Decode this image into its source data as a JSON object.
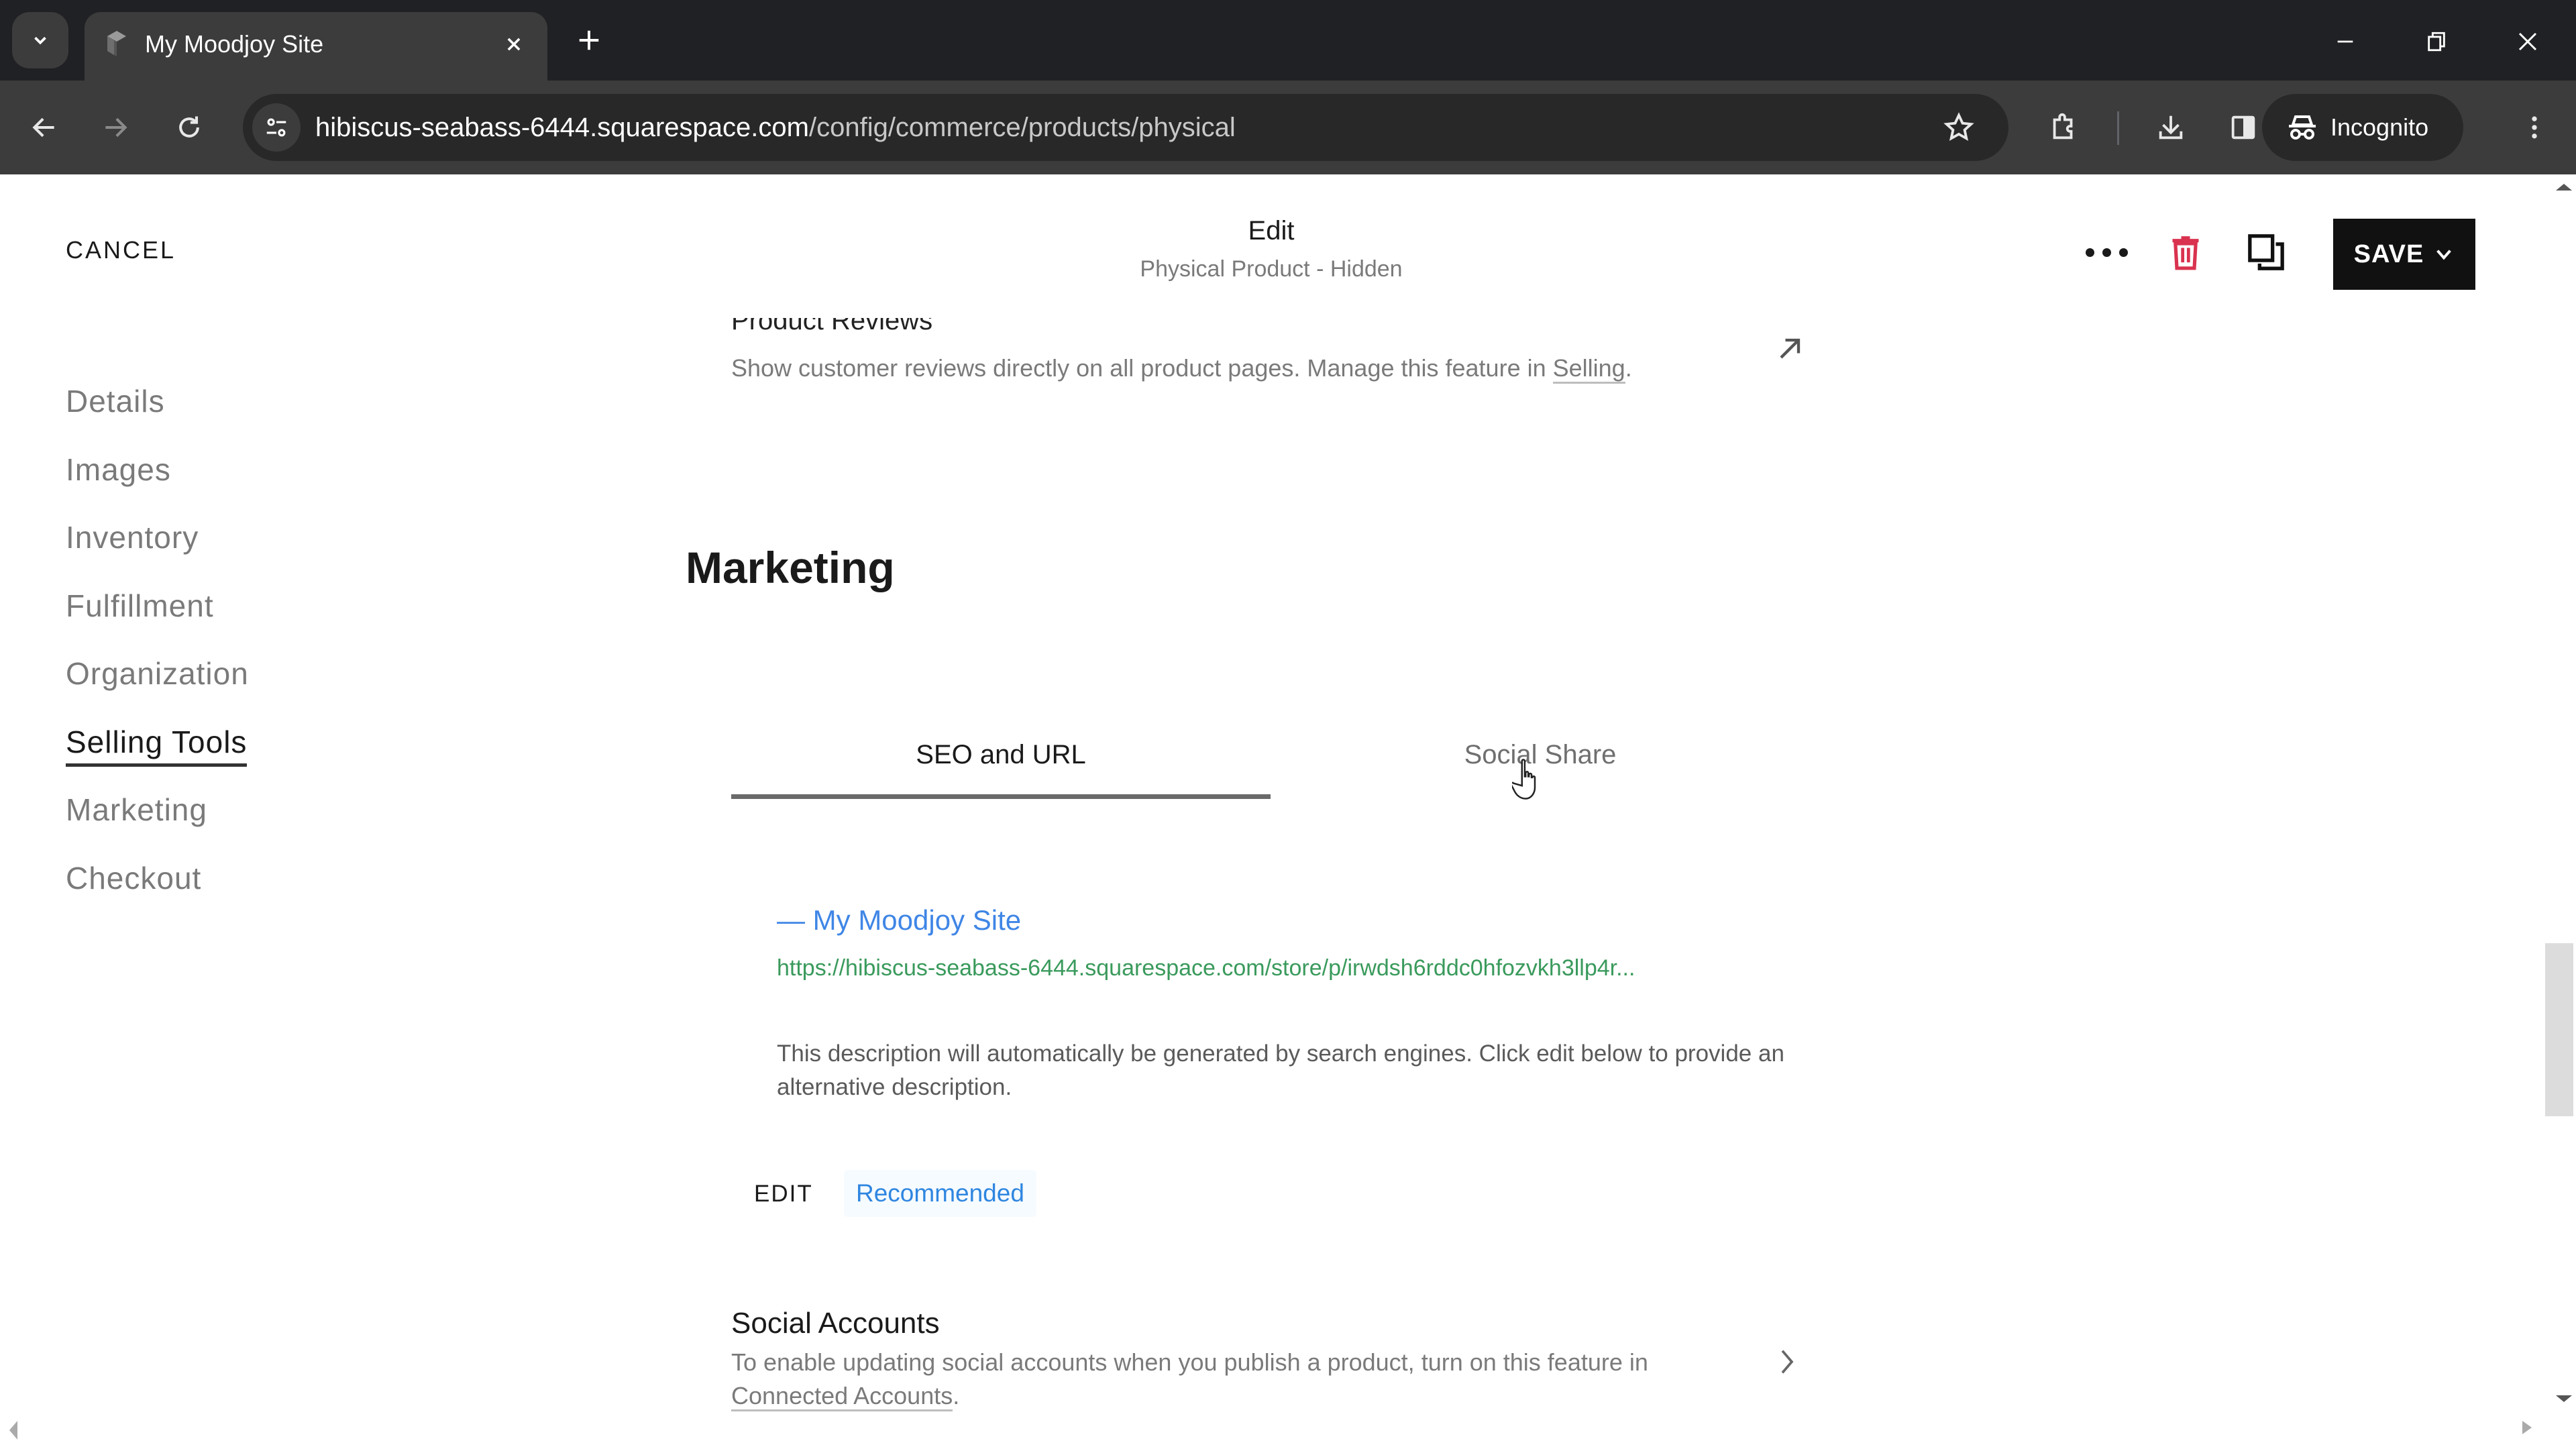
{
  "browser": {
    "tab_title": "My Moodjoy Site",
    "url_host": "hibiscus-seabass-6444.squarespace.com",
    "url_path": "/config/commerce/products/physical",
    "incognito_label": "Incognito",
    "icons": {
      "tab_search": "chevron-down-icon",
      "favicon": "squarespace-cube-icon",
      "tab_close": "close-icon",
      "new_tab": "plus-icon",
      "back": "arrow-left-icon",
      "forward": "arrow-right-icon",
      "reload": "reload-icon",
      "site_info": "tune-icon",
      "bookmark": "star-icon",
      "extensions": "puzzle-icon",
      "downloads": "download-icon",
      "side_panel": "side-panel-icon",
      "incognito": "incognito-icon",
      "menu": "kebab-menu-icon",
      "minimize": "minimize-icon",
      "restore": "restore-icon",
      "close_window": "close-icon"
    }
  },
  "header": {
    "cancel_label": "CANCEL",
    "title": "Edit",
    "subtitle": "Physical Product - Hidden",
    "save_label": "SAVE",
    "colors": {
      "trash": "#d9334f",
      "save_bg": "#111111"
    }
  },
  "sidenav": {
    "items": [
      {
        "label": "Details",
        "active": false
      },
      {
        "label": "Images",
        "active": false
      },
      {
        "label": "Inventory",
        "active": false
      },
      {
        "label": "Fulfillment",
        "active": false
      },
      {
        "label": "Organization",
        "active": false
      },
      {
        "label": "Selling Tools",
        "active": true
      },
      {
        "label": "Marketing",
        "active": false
      },
      {
        "label": "Checkout",
        "active": false
      }
    ]
  },
  "reviews": {
    "title": "Product Reviews",
    "desc_prefix": "Show customer reviews directly on all product pages. Manage this feature in ",
    "desc_link": "Selling",
    "desc_suffix": "."
  },
  "marketing": {
    "title": "Marketing",
    "tabs": [
      {
        "label": "SEO and URL",
        "active": true
      },
      {
        "label": "Social Share",
        "active": false
      }
    ],
    "seo_preview": {
      "site_title": "— My Moodjoy Site",
      "url": "https://hibiscus-seabass-6444.squarespace.com/store/p/irwdsh6rddc0hfozvkh3llp4r...",
      "description": "This description will automatically be generated by search engines. Click edit below to provide an alternative description.",
      "colors": {
        "title": "#3f86e6",
        "url": "#3a9a5c"
      }
    },
    "edit_label": "EDIT",
    "recommended_label": "Recommended"
  },
  "social_accounts": {
    "title": "Social Accounts",
    "desc_prefix": "To enable updating social accounts when you publish a product, turn on this feature in ",
    "desc_link": "Connected Accounts",
    "desc_suffix": "."
  }
}
